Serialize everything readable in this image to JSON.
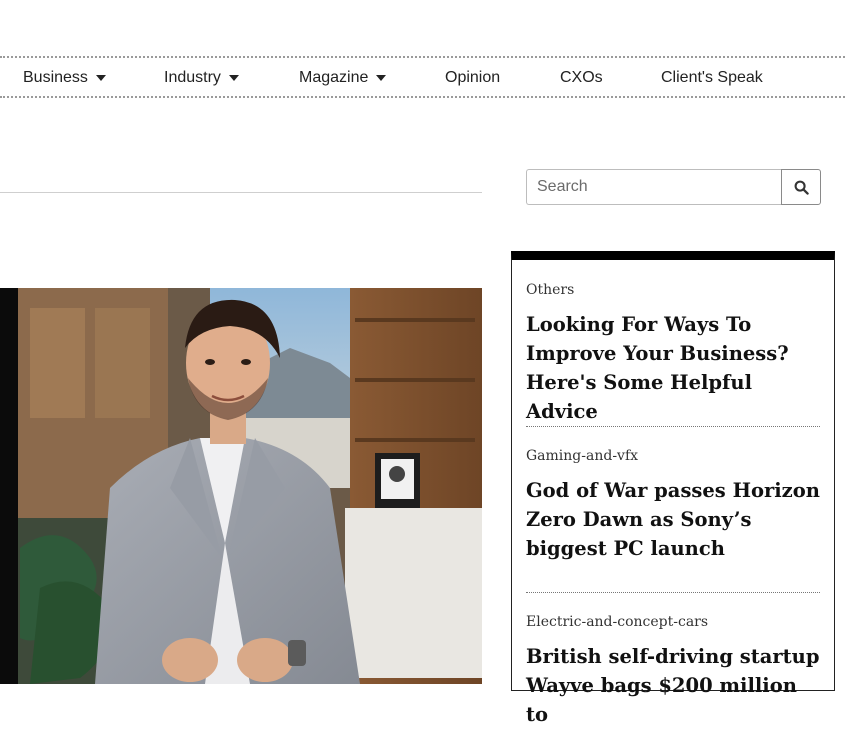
{
  "nav": {
    "items": [
      {
        "label": "Business",
        "dropdown": true
      },
      {
        "label": "Industry",
        "dropdown": true
      },
      {
        "label": "Magazine",
        "dropdown": true
      },
      {
        "label": "Opinion",
        "dropdown": false
      },
      {
        "label": "CXOs",
        "dropdown": false
      },
      {
        "label": "Client's Speak",
        "dropdown": false
      }
    ]
  },
  "search": {
    "placeholder": "Search",
    "icon": "search-icon"
  },
  "sidebar": {
    "stories": [
      {
        "category": "Others",
        "title": "Looking For Ways To Improve Your Business? Here's Some Helpful Advice"
      },
      {
        "category": "Gaming-and-vfx",
        "title": "God of War passes Horizon Zero Dawn as Sony’s biggest PC launch"
      },
      {
        "category": "Electric-and-concept-cars",
        "title": "British self-driving startup Wayve bags $200 million to"
      }
    ]
  },
  "colors": {
    "accent": "#000000",
    "nav_border": "#9a9a9a"
  }
}
